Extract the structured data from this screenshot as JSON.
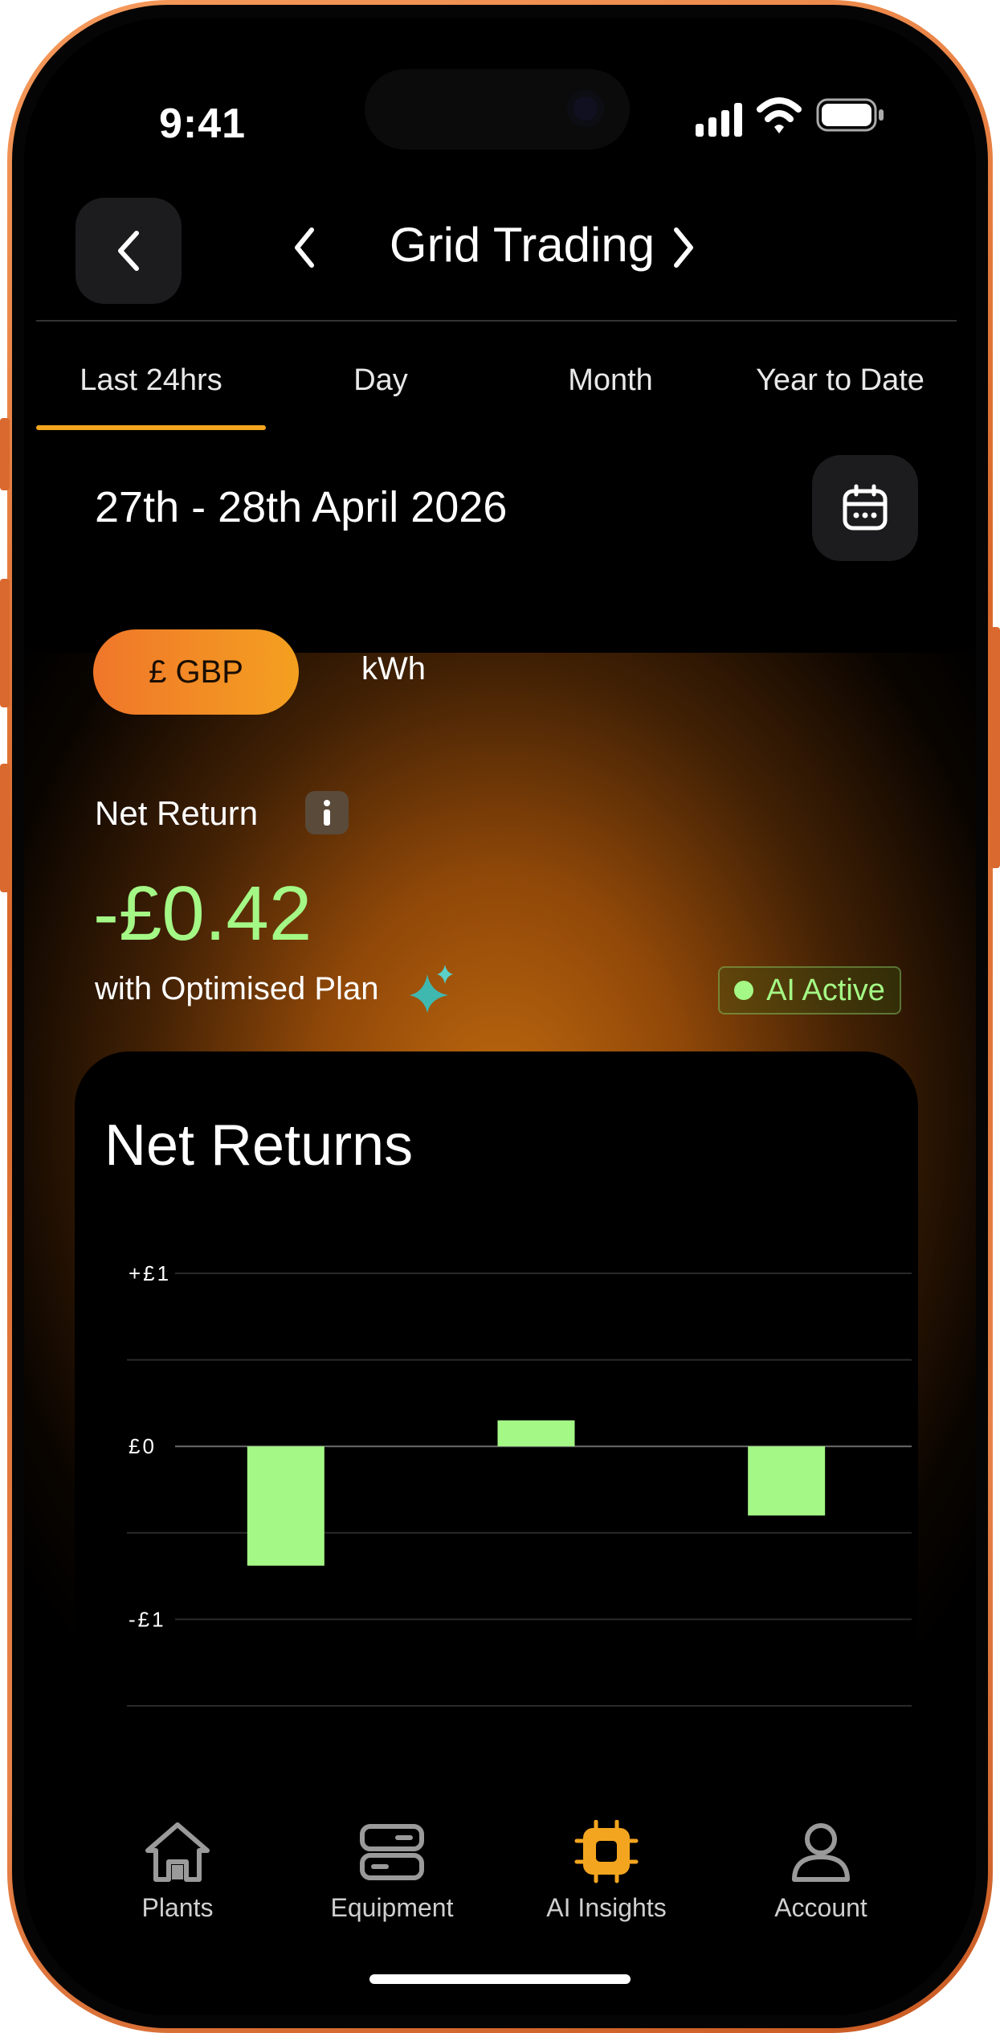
{
  "status_bar": {
    "time": "9:41"
  },
  "header": {
    "title": "Grid Trading"
  },
  "tabs": [
    {
      "label": "Last 24hrs",
      "active": true
    },
    {
      "label": "Day",
      "active": false
    },
    {
      "label": "Month",
      "active": false
    },
    {
      "label": "Year to Date",
      "active": false
    }
  ],
  "date_range": "27th - 28th April 2026",
  "unit_toggle": {
    "gbp_label": "£ GBP",
    "kwh_label": "kWh",
    "selected": "£ GBP"
  },
  "summary": {
    "label": "Net Return",
    "value": "-£0.42",
    "plan_text": "with Optimised Plan",
    "ai_badge": "AI Active"
  },
  "card": {
    "title": "Net Returns"
  },
  "chart_data": {
    "type": "bar",
    "title": "Net Returns",
    "ylim": [
      -1.5,
      1
    ],
    "y_ticks": [
      {
        "label": "+£1",
        "value": 1
      },
      {
        "label": "£0",
        "value": 0
      },
      {
        "label": "-£1",
        "value": -1
      }
    ],
    "grid": true,
    "values": [
      -0.69,
      0.15,
      -0.4
    ]
  },
  "bottom_nav": [
    {
      "label": "Plants",
      "icon": "home-icon",
      "active": false
    },
    {
      "label": "Equipment",
      "icon": "equipment-icon",
      "active": false
    },
    {
      "label": "AI Insights",
      "icon": "chip-icon",
      "active": true
    },
    {
      "label": "Account",
      "icon": "user-icon",
      "active": false
    }
  ],
  "colors": {
    "accent_orange": "#f4a51f",
    "positive_green": "#a4f885",
    "background": "#000000"
  }
}
